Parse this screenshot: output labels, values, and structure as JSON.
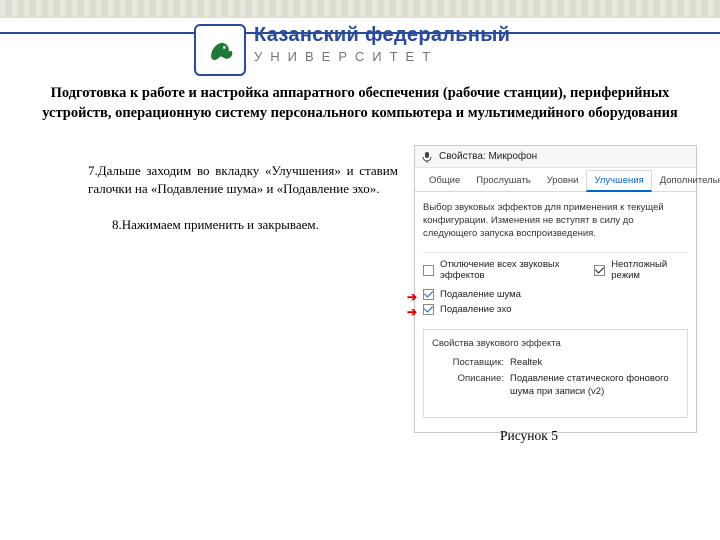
{
  "header": {
    "brand_line1": "Казанский федеральный",
    "brand_line2": "УНИВЕРСИТЕТ"
  },
  "doc": {
    "title": "Подготовка к работе и настройка аппаратного обеспечения (рабочие станции), периферийных устройств, операционную систему персонального компьютера и мультимедийного оборудования",
    "step7": "7.Дальше заходим во вкладку «Улучшения» и ставим галочки на «Подавление шума» и «Подавление эхо».",
    "step8": "8.Нажимаем применить и закрываем.",
    "caption": "Рисунок 5"
  },
  "dialog": {
    "title": "Свойства: Микрофон",
    "tabs": [
      "Общие",
      "Прослушать",
      "Уровни",
      "Улучшения",
      "Дополнительно"
    ],
    "active_tab_index": 3,
    "description": "Выбор звуковых эффектов для применения к текущей конфигурации. Изменения не вступят в силу до следующего запуска воспроизведения.",
    "disable_all_label": "Отключение всех звуковых эффектов",
    "urgent_mode_label": "Неотложный режим",
    "options": [
      {
        "label": "Подавление шума",
        "checked": true
      },
      {
        "label": "Подавление эхо",
        "checked": true
      }
    ],
    "effect_props": {
      "title": "Свойства звукового эффекта",
      "provider_label": "Поставщик:",
      "provider_value": "Realtek",
      "desc_label": "Описание:",
      "desc_value": "Подавление статического фонового шума при записи (v2)"
    }
  }
}
